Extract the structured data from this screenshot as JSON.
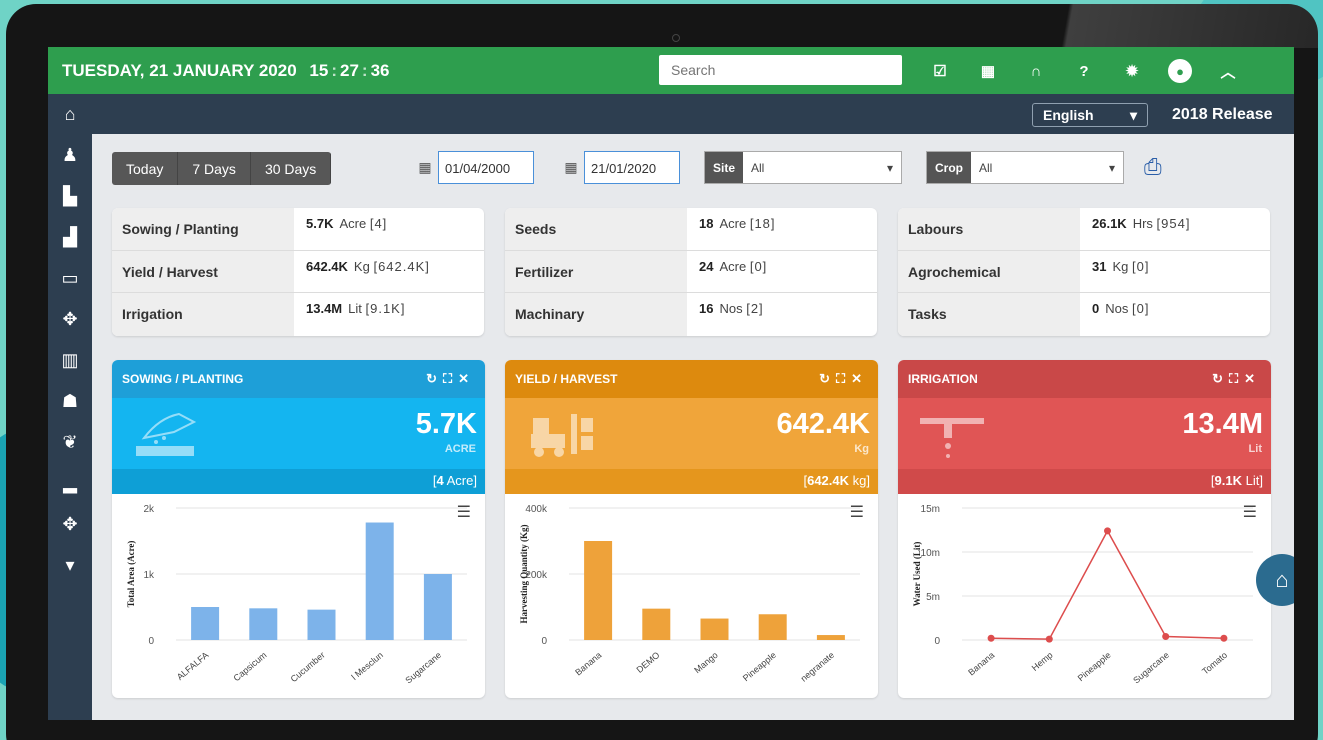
{
  "header": {
    "date": "TUESDAY, 21 JANUARY 2020",
    "time_h": "15",
    "time_m": "27",
    "time_s": "36",
    "search_placeholder": "Search",
    "icons": [
      "checkbox-icon",
      "grid-icon",
      "headset-icon",
      "help-icon",
      "gear-icon",
      "user-icon",
      "chevron-up-icon"
    ]
  },
  "subbar": {
    "language": "English",
    "release": "2018 Release"
  },
  "sidebar": {
    "items": [
      "home-icon",
      "user-icon",
      "building-icon",
      "city-icon",
      "monitor-icon",
      "crop-icon",
      "warehouse-icon",
      "people-icon",
      "leaf-icon",
      "factory-icon",
      "crop-alt-icon",
      "caret-down-icon"
    ]
  },
  "filters": {
    "ranges": [
      "Today",
      "7 Days",
      "30 Days"
    ],
    "date_from": "01/04/2000",
    "date_to": "21/01/2020",
    "site_label": "Site",
    "site_value": "All",
    "crop_label": "Crop",
    "crop_value": "All"
  },
  "stats": [
    {
      "rows": [
        {
          "label": "Sowing / Planting",
          "value": "5.7K",
          "unit": "Acre",
          "bracket": "[4]"
        },
        {
          "label": "Yield / Harvest",
          "value": "642.4K",
          "unit": "Kg",
          "bracket": "[642.4K]"
        },
        {
          "label": "Irrigation",
          "value": "13.4M",
          "unit": "Lit",
          "bracket": "[9.1K]"
        }
      ]
    },
    {
      "rows": [
        {
          "label": "Seeds",
          "value": "18",
          "unit": "Acre",
          "bracket": "[18]"
        },
        {
          "label": "Fertilizer",
          "value": "24",
          "unit": "Acre",
          "bracket": "[0]"
        },
        {
          "label": "Machinary",
          "value": "16",
          "unit": "Nos",
          "bracket": "[2]"
        }
      ]
    },
    {
      "rows": [
        {
          "label": "Labours",
          "value": "26.1K",
          "unit": "Hrs",
          "bracket": "[954]"
        },
        {
          "label": "Agrochemical",
          "value": "31",
          "unit": "Kg",
          "bracket": "[0]"
        },
        {
          "label": "Tasks",
          "value": "0",
          "unit": "Nos",
          "bracket": "[0]"
        }
      ]
    }
  ],
  "panels": [
    {
      "title": "SOWING / PLANTING",
      "big": "5.7K",
      "unit": "ACRE",
      "foot_val": "4",
      "foot_unit": "Acre",
      "header_color": "#1e9fd8",
      "body_color": "#14b5f0"
    },
    {
      "title": "YIELD / HARVEST",
      "big": "642.4K",
      "unit": "Kg",
      "foot_val": "642.4K",
      "foot_unit": "kg",
      "header_color": "#dd8a0e",
      "body_color": "#f0a53a"
    },
    {
      "title": "IRRIGATION",
      "big": "13.4M",
      "unit": "Lit",
      "foot_val": "9.1K",
      "foot_unit": "Lit",
      "header_color": "#c94848",
      "body_color": "#e05555"
    }
  ],
  "chart_data": [
    {
      "type": "bar",
      "ylabel": "Total Area (Acre)",
      "ylim": [
        0,
        2000
      ],
      "yticks": [
        "0",
        "1k",
        "2k"
      ],
      "categories": [
        "ALFALFA",
        "Capsicum",
        "Cucumber",
        "l Mesclun",
        "Sugarcane"
      ],
      "values": [
        500,
        480,
        460,
        1780,
        1000
      ],
      "color": "#7db3ea"
    },
    {
      "type": "bar",
      "ylabel": "Harvesting Quantity (Kg)",
      "ylim": [
        0,
        400000
      ],
      "yticks": [
        "0",
        "200k",
        "400k"
      ],
      "categories": [
        "Banana",
        "DEMO",
        "Mango",
        "Pineapple",
        "negranate"
      ],
      "values": [
        300000,
        95000,
        65000,
        78000,
        15000
      ],
      "color": "#eea23a"
    },
    {
      "type": "line",
      "ylabel": "Water Used (Lit)",
      "ylim": [
        0,
        15000000
      ],
      "yticks": [
        "0",
        "5m",
        "10m",
        "15m"
      ],
      "categories": [
        "Banana",
        "Hemp",
        "Pineapple",
        "Sugarcane",
        "Tomato"
      ],
      "values": [
        200000,
        100000,
        12400000,
        400000,
        200000
      ],
      "color": "#dd4d4d"
    }
  ]
}
